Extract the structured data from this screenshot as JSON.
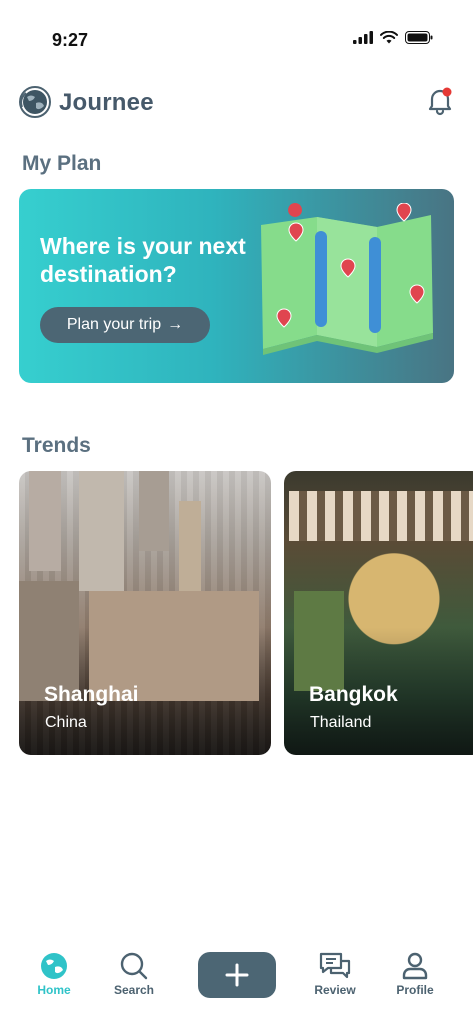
{
  "status_bar": {
    "time": "9:27"
  },
  "header": {
    "app_name": "Journee"
  },
  "my_plan": {
    "title": "My Plan",
    "banner_heading": "Where is your next destination?",
    "cta_label": "Plan your trip",
    "cta_arrow": "→"
  },
  "trends": {
    "title": "Trends",
    "cards": [
      {
        "city": "Shanghai",
        "country": "China"
      },
      {
        "city": "Bangkok",
        "country": "Thailand"
      }
    ]
  },
  "nav": {
    "items": [
      {
        "label": "Home",
        "icon": "globe-icon",
        "active": true
      },
      {
        "label": "Search",
        "icon": "search-icon",
        "active": false
      },
      {
        "label": "",
        "icon": "plus-icon",
        "active": false
      },
      {
        "label": "Review",
        "icon": "review-icon",
        "active": false
      },
      {
        "label": "Profile",
        "icon": "profile-icon",
        "active": false
      }
    ]
  },
  "colors": {
    "accent": "#2fc3c8",
    "primary_dark": "#4c6674",
    "notification_dot": "#e53935"
  }
}
